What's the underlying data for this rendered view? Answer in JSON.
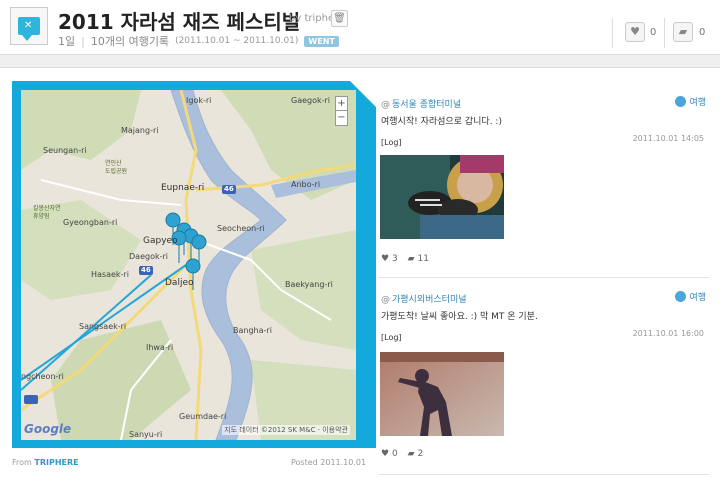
{
  "header": {
    "title": "2011 자라섬 재즈 페스티벌",
    "byline": "by triphere",
    "trash_icon": "trash-icon",
    "days": "1일",
    "records": "10개의 여행기록",
    "date_range": "(2011.10.01 ~ 2011.10.01)",
    "status_badge": "WENT",
    "likes": "0",
    "comments": "0",
    "accent": "#2fb5dc"
  },
  "map": {
    "places": {
      "igok": "Igok-ri",
      "gaegok": "Gaegok-ri",
      "majang": "Majang-ri",
      "seungan": "Seungan-ri",
      "anbo": "Anbo-ri",
      "eupnae": "Eupnae-ri",
      "gyeongban": "Gyeongban-ri",
      "gapyeong": "Gapyeo",
      "seocheon": "Seocheon-ri",
      "daegok": "Daegok-ri",
      "hasaek": "Hasaek-ri",
      "daljeon": "Daljeo",
      "baekyang": "Baekyang-ri",
      "sangsaek": "Sangsaek-ri",
      "bangha": "Bangha-ri",
      "ihwa": "Ihwa-ri",
      "ngcheon": "ngcheon-ri",
      "geumdae": "Geumdae-ri",
      "sanyu": "Sanyu-ri",
      "yeonin": "연인산\n도립공원",
      "kaldeok": "칼봉산자연\n휴양림"
    },
    "route_num_46a": "46",
    "route_num_46b": "46",
    "zoom_in": "+",
    "zoom_out": "−",
    "logo": "Google",
    "copyright": "지도 데이터 ©2012 SK M&C · 이용약관"
  },
  "footer": {
    "from_label": "From",
    "from_source": "TRIPHERE",
    "posted": "Posted 2011.10.01"
  },
  "posts": [
    {
      "location": "동서울 종합터미널",
      "tag": "여행",
      "text": "여행시작! 자라섬으로 갑니다. :)",
      "log": "[Log]",
      "time": "2011.10.01 14:05",
      "likes": "3",
      "comments": "11"
    },
    {
      "location": "가평시외버스터미널",
      "tag": "여행",
      "text": "가평도착! 날씨 좋아요. :) 막 MT 온 기분.",
      "log": "[Log]",
      "time": "2011.10.01 16:00",
      "likes": "0",
      "comments": "2"
    }
  ]
}
